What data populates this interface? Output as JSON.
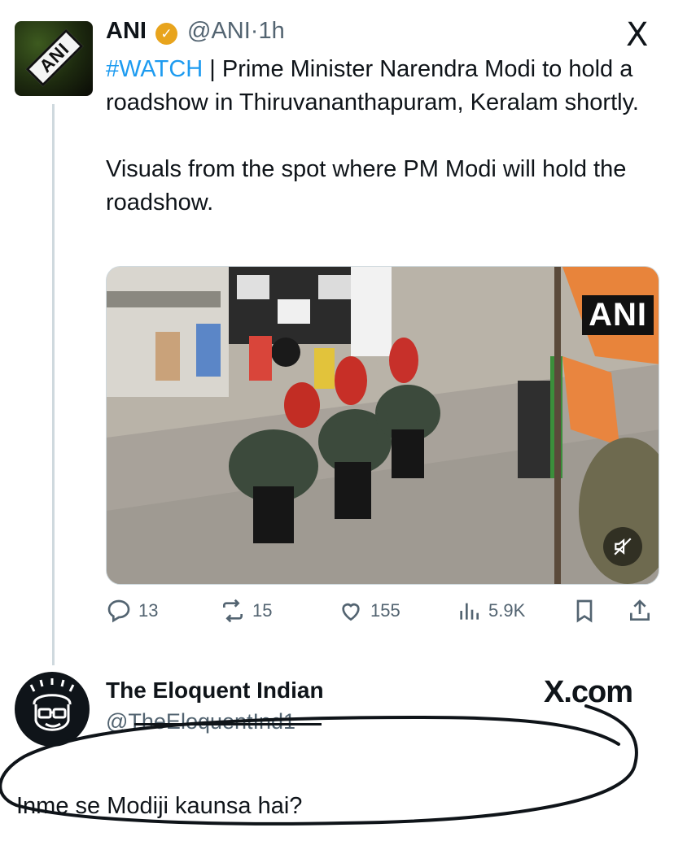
{
  "tweet": {
    "author_name": "ANI",
    "handle": "@ANI",
    "separator": "·",
    "time": "1h",
    "hashtag": "#WATCH",
    "text_line1_rest": " | Prime Minister Narendra Modi to hold a roadshow in Thiruvananthapuram, Keralam shortly.",
    "text_para2": "Visuals from the spot where PM Modi will hold the roadshow.",
    "avatar_label": "ANI",
    "media_watermark": "ANI",
    "stats": {
      "replies": "13",
      "reposts": "15",
      "likes": "155",
      "views": "5.9K"
    }
  },
  "reply": {
    "author_name": "The Eloquent Indian",
    "handle": "@TheEloquentInd1",
    "text": "Inme se Modiji kaunsa hai?",
    "site": "X.com"
  },
  "platform_logo": "X",
  "colors": {
    "accent": "#1d9bf0",
    "verified": "#e8a41d",
    "muted": "#536471"
  }
}
